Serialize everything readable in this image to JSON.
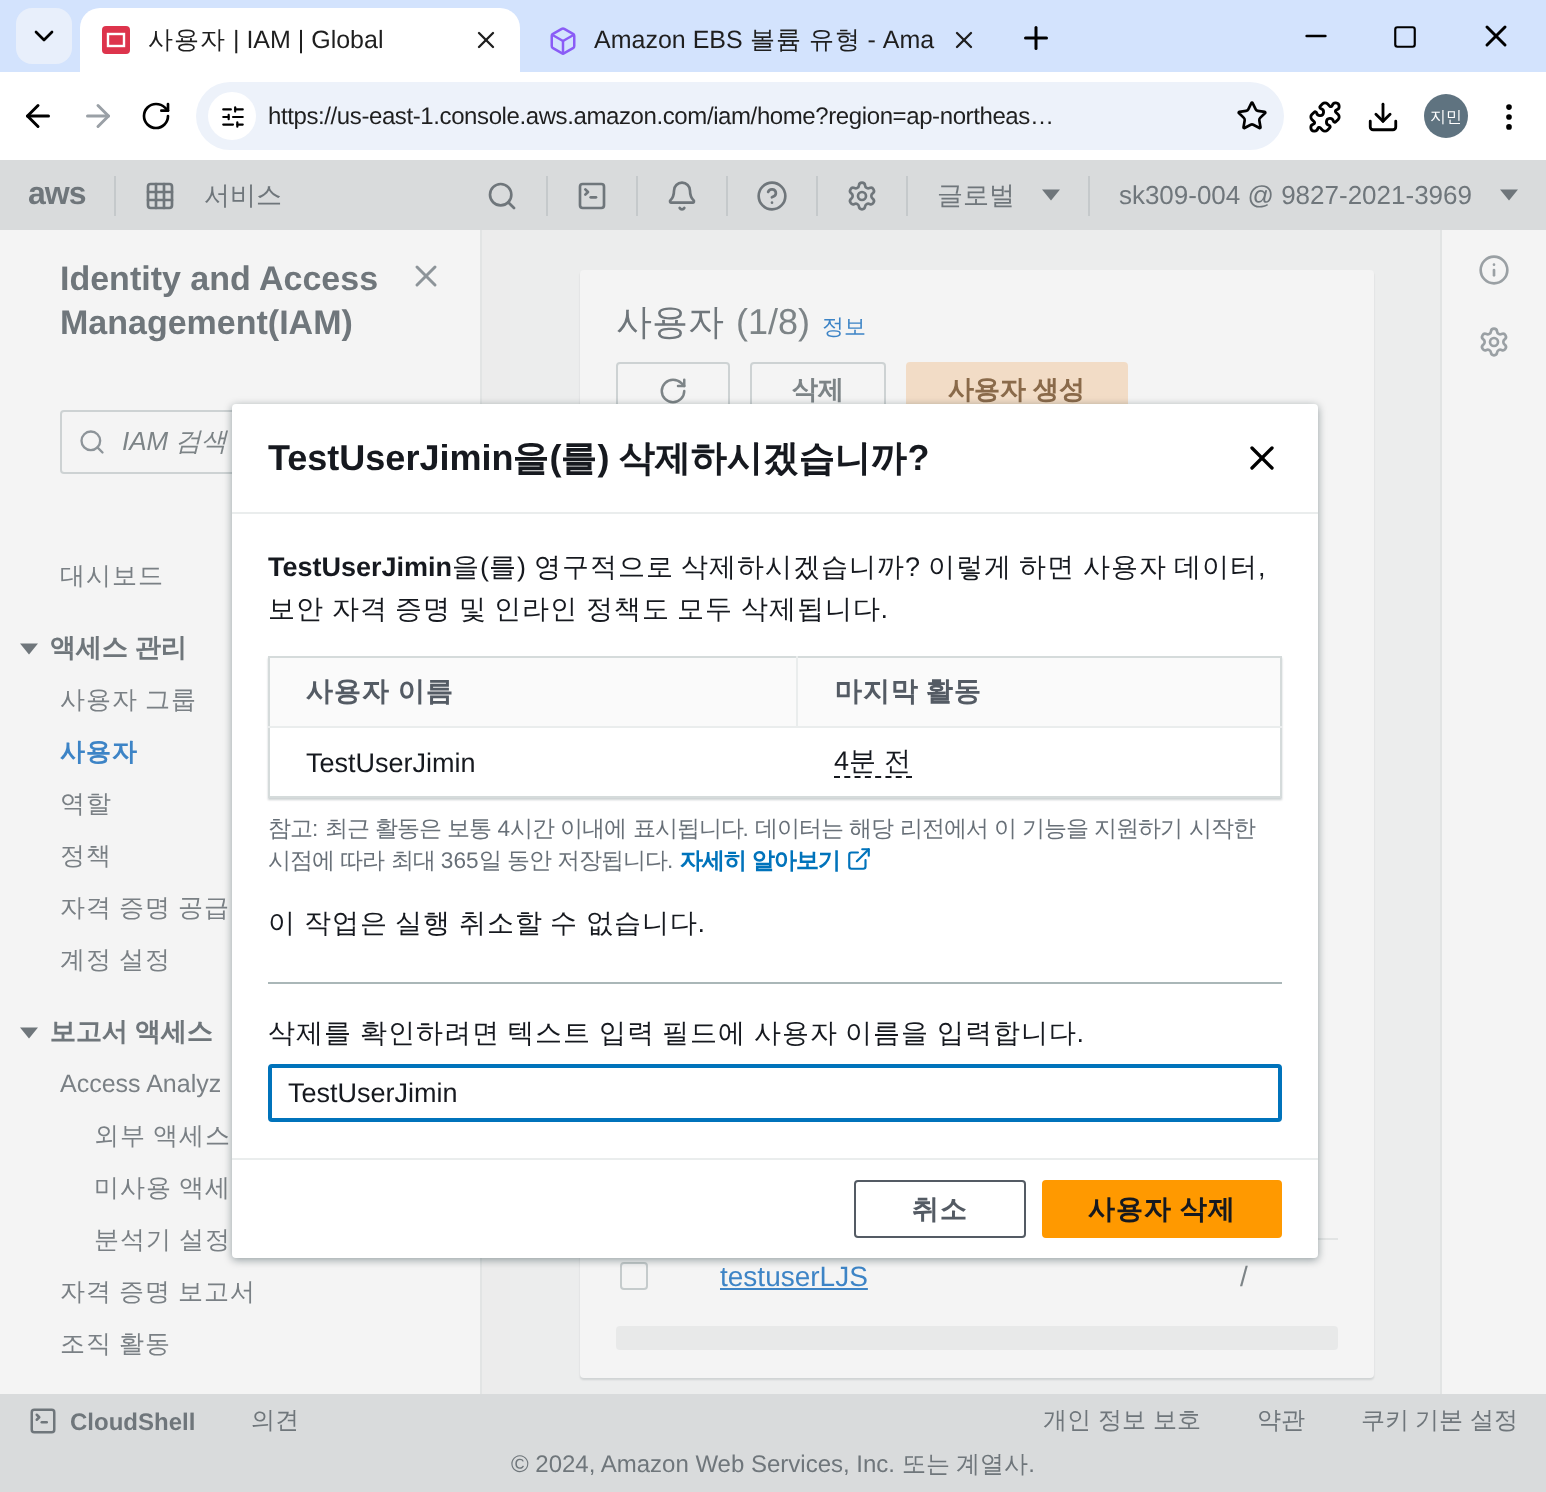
{
  "browser": {
    "tabs": [
      {
        "title": "사용자 | IAM | Global",
        "kind": "iam",
        "selected": true
      },
      {
        "title": "Amazon EBS 볼륨 유형 - Ama",
        "kind": "ebs",
        "selected": false
      }
    ],
    "url": "https://us-east-1.console.aws.amazon.com/iam/home?region=ap-northeas…",
    "profile": "지민"
  },
  "aws_nav": {
    "logo": "aws",
    "services": "서비스",
    "region": "글로벌",
    "account": "sk309-004 @ 9827-2021-3969"
  },
  "sidebar": {
    "title": "Identity and Access Management(IAM)",
    "search_placeholder": "IAM 검색",
    "items": [
      {
        "label": "대시보드",
        "kind": "link",
        "selected": false
      },
      {
        "label": "액세스 관리",
        "kind": "section",
        "expanded": true,
        "children": [
          {
            "label": "사용자 그룹",
            "kind": "link",
            "selected": false
          },
          {
            "label": "사용자",
            "kind": "link",
            "selected": true
          },
          {
            "label": "역할",
            "kind": "link",
            "selected": false
          },
          {
            "label": "정책",
            "kind": "link",
            "selected": false
          },
          {
            "label": "자격 증명 공급",
            "kind": "link",
            "selected": false
          },
          {
            "label": "계정 설정",
            "kind": "link",
            "selected": false
          }
        ]
      },
      {
        "label": "보고서 액세스",
        "kind": "section",
        "expanded": true,
        "children": [
          {
            "label": "Access Analyz",
            "kind": "link",
            "selected": false,
            "children": [
              {
                "label": "외부 액세스",
                "kind": "link",
                "selected": false
              },
              {
                "label": "미사용 액세",
                "kind": "link",
                "selected": false
              },
              {
                "label": "분석기 설정",
                "kind": "link",
                "selected": false
              }
            ]
          },
          {
            "label": "자격 증명 보고서",
            "kind": "link",
            "selected": false
          },
          {
            "label": "조직 활동",
            "kind": "link",
            "selected": false
          }
        ]
      }
    ]
  },
  "main": {
    "heading": "사용자",
    "count": "(1/8)",
    "info": "정보",
    "buttons": [
      {
        "label": "삭제",
        "kind": "normal"
      },
      {
        "label": "사용자 생성",
        "kind": "primary"
      }
    ],
    "rows": [
      {
        "name": "testuserLJS",
        "checked": false,
        "column_3": "/"
      }
    ]
  },
  "modal": {
    "title": "TestUserJimin을(를) 삭제하시겠습니까?",
    "message": "**TestUserJimin**을(를) 영구적으로 삭제하시겠습니까? 이렇게 하면 사용자 데이터, 보안 자격 증명 및 인라인 정책도 모두 삭제됩니다.",
    "table": {
      "columns": [
        "사용자 이름",
        "마지막 활동"
      ],
      "rows": [
        [
          "TestUserJimin",
          "4분 전"
        ]
      ]
    },
    "note": "참고: 최근 활동은 보통 4시간 이내에 표시됩니다. 데이터는 해당 리전에서 이 기능을 지원하기 시작한 시점에 따라 최대 365일 동안 저장됩니다.",
    "note_link": "자세히 알아보기",
    "warning": "이 작업은 실행 취소할 수 없습니다.",
    "confirm_label": "삭제를 확인하려면 텍스트 입력 필드에 사용자 이름을 입력합니다.",
    "confirm_value": "TestUserJimin",
    "buttons": [
      {
        "label": "취소",
        "kind": "normal"
      },
      {
        "label": "사용자 삭제",
        "kind": "primary"
      }
    ]
  },
  "footer": {
    "cloudshell": "CloudShell",
    "feedback": "의견",
    "links": [
      "개인 정보 보호",
      "약관",
      "쿠키 기본 설정"
    ],
    "copyright": "© 2024, Amazon Web Services, Inc. 또는 계열사."
  }
}
